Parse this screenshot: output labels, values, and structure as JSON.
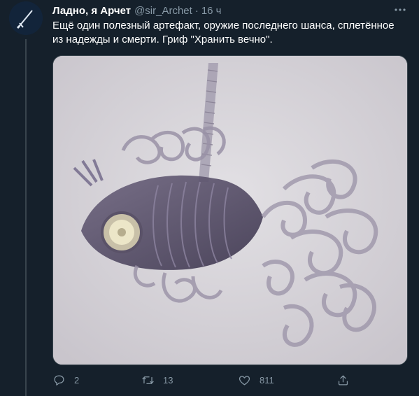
{
  "tweet": {
    "display_name": "Ладно, я Арчет",
    "handle": "@sir_Archet",
    "separator": "·",
    "time": "16 ч",
    "text": "Ещё один полезный артефакт, оружие последнего шанса, сплетённое из надежды и смерти. Гриф \"Хранить вечно\".",
    "media_description": "Фигура рыбы из пластиковых трубок и прокладок"
  },
  "actions": {
    "reply_count": "2",
    "retweet_count": "13",
    "like_count": "811"
  },
  "icons": {
    "avatar": "sword-avatar",
    "more": "more-icon",
    "reply": "reply-icon",
    "retweet": "retweet-icon",
    "like": "heart-icon",
    "share": "share-icon"
  },
  "colors": {
    "background": "#15202b",
    "secondary_text": "#8899a6",
    "border": "#38444d"
  }
}
